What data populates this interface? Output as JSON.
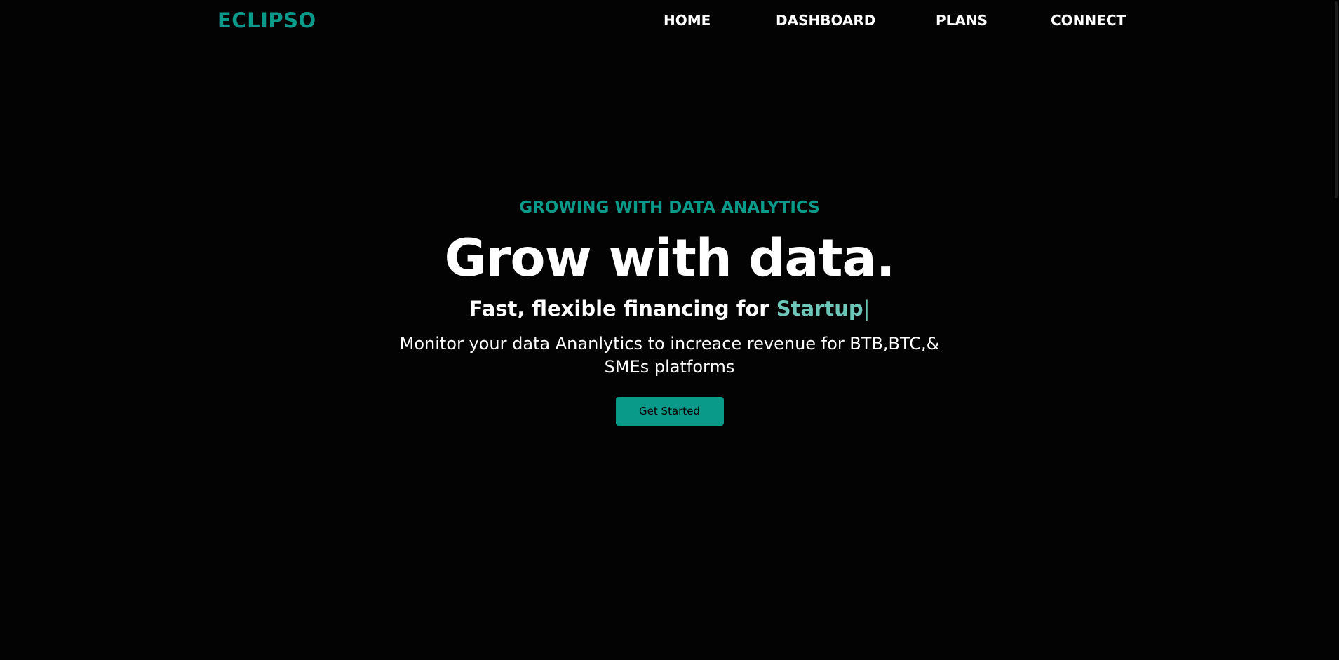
{
  "brand": {
    "name": "ECLIPSO",
    "accent_color": "#0a9a8a"
  },
  "nav": {
    "items": [
      {
        "label": "HOME"
      },
      {
        "label": "DASHBOARD"
      },
      {
        "label": "PLANS"
      },
      {
        "label": "CONNECT"
      }
    ]
  },
  "hero": {
    "eyebrow": "GROWING WITH DATA ANALYTICS",
    "headline": "Grow with data.",
    "subheadline_prefix": "Fast, flexible financing for ",
    "subheadline_highlight": "Startup",
    "cursor": "|",
    "highlight_color": "#6cc7b8",
    "description": "Monitor your data Ananlytics to increace revenue for BTB,BTC,& SMEs platforms",
    "cta_label": "Get Started"
  }
}
